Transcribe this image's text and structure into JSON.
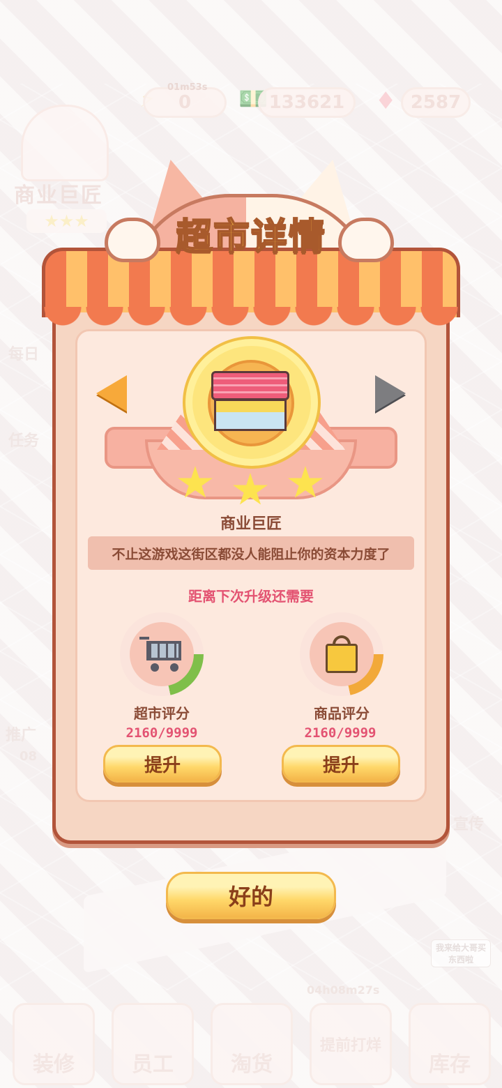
{
  "hud": {
    "energy_value": "0",
    "energy_timer": "01m53s",
    "cash_value": "133621",
    "gem_value": "2587"
  },
  "background": {
    "rank_label": "商业巨匠",
    "side_daily": "每日",
    "side_task": "任务",
    "side_promo": "推广",
    "side_promo_timer": "08",
    "side_ad": "宣传",
    "npc_speech": "我来给大哥买东西啦",
    "bottom_timer": "04h08m27s",
    "bottom_buttons": [
      "装修",
      "员工",
      "淘货",
      "提前打烊",
      "库存"
    ]
  },
  "dialog": {
    "title": "超市详情",
    "rank_name": "商业巨匠",
    "rank_stars": 3,
    "description": "不止这游戏这街区都没人能阻止你的资本力度了",
    "next_level_label": "距离下次升级还需要",
    "store_rating": {
      "label": "超市评分",
      "value": "2160/9999",
      "progress": 0.216,
      "color": "#7fbf4a",
      "button": "提升"
    },
    "goods_rating": {
      "label": "商品评分",
      "value": "2160/9999",
      "progress": 0.216,
      "color": "#f2a93a",
      "button": "提升"
    },
    "ok_button": "好的"
  }
}
